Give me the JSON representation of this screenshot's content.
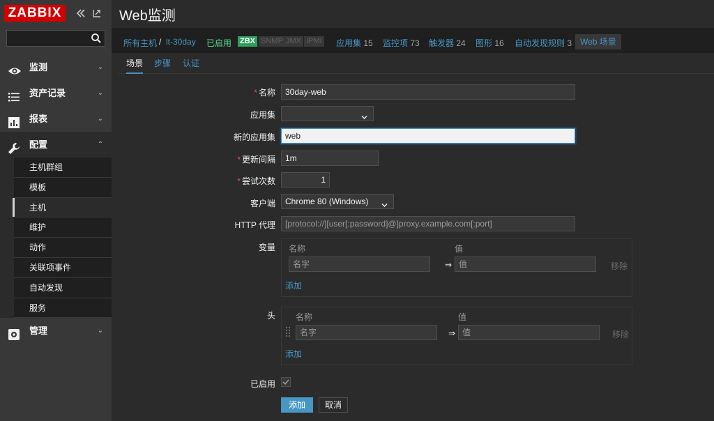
{
  "app": {
    "logo": "ZABBIX"
  },
  "sidebar": {
    "search_value": "",
    "menu": [
      {
        "label": "监测",
        "icon": "eye-icon"
      },
      {
        "label": "资产记录",
        "icon": "list-icon"
      },
      {
        "label": "报表",
        "icon": "bar-chart-icon"
      },
      {
        "label": "配置",
        "icon": "wrench-icon"
      },
      {
        "label": "管理",
        "icon": "gear-icon"
      }
    ],
    "config_items": [
      "主机群组",
      "模板",
      "主机",
      "维护",
      "动作",
      "关联项事件",
      "自动发现",
      "服务"
    ],
    "selected_item": "主机"
  },
  "header": {
    "title": "Web监测"
  },
  "breadcrumb": {
    "all_hosts": "所有主机",
    "separator": "/",
    "host": "lt-30day",
    "enabled": "已启用",
    "zbx": "ZBX",
    "snmp": "SNMP",
    "jmx": "JMX",
    "ipmi": "IPMI",
    "app_sets": "应用集",
    "app_sets_count": "15",
    "items": "监控项",
    "items_count": "73",
    "triggers": "触发器",
    "triggers_count": "24",
    "graphs": "图形",
    "graphs_count": "16",
    "discovery": "自动发现规则",
    "discovery_count": "3",
    "web": "Web 场景"
  },
  "tabs": [
    "场景",
    "步骤",
    "认证"
  ],
  "form": {
    "name_label": "名称",
    "name_value": "30day-web",
    "app_label": "应用集",
    "app_value": "",
    "new_app_label": "新的应用集",
    "new_app_value": "web",
    "interval_label": "更新间隔",
    "interval_value": "1m",
    "attempts_label": "尝试次数",
    "attempts_value": "1",
    "agent_label": "客户端",
    "agent_value": "Chrome 80 (Windows)",
    "proxy_label": "HTTP 代理",
    "proxy_placeholder": "[protocol://][user[:password]@]proxy.example.com[:port]",
    "variables_label": "变量",
    "headers_label": "头",
    "col_name": "名称",
    "col_value": "值",
    "name_placeholder": "名字",
    "value_placeholder": "值",
    "arrow": "⇒",
    "remove": "移除",
    "add": "添加",
    "enabled_label": "已启用",
    "enabled_checked": true,
    "submit": "添加",
    "cancel": "取消"
  },
  "colors": {
    "accent": "#4796c4",
    "enabled": "#59db8f",
    "zbx_badge": "#2f9f5e",
    "logo_red": "#d40000"
  }
}
